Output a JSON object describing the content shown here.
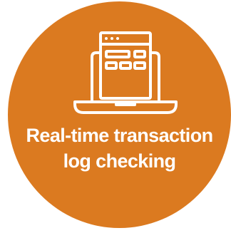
{
  "badge": {
    "background_color": "#db7a20",
    "foreground_color": "#ffffff",
    "icon": "laptop-browser-window-icon",
    "caption_line_1": "Real-time transaction",
    "caption_line_2": "log checking"
  }
}
